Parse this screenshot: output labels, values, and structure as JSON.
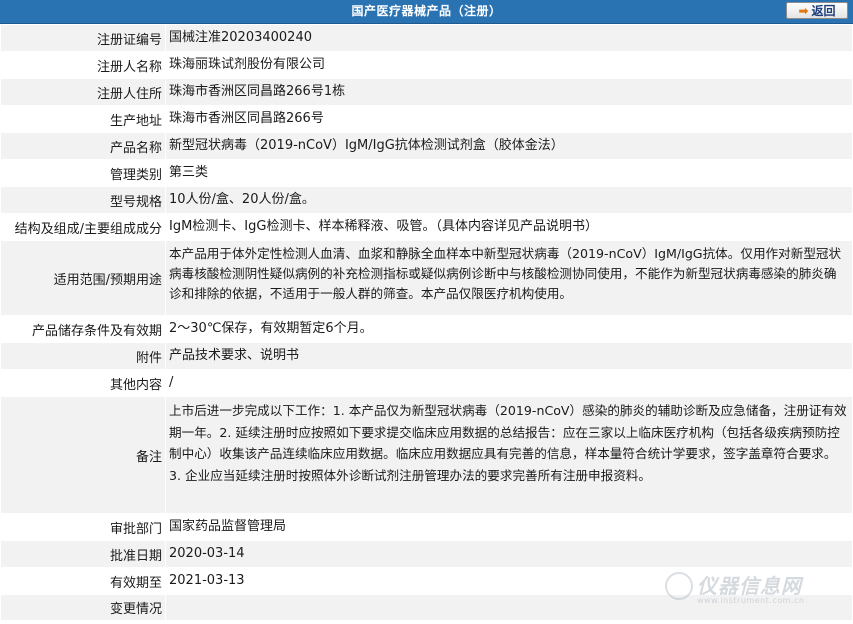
{
  "header": {
    "title": "国产医疗器械产品（注册）",
    "back_label": "返回"
  },
  "rows": [
    {
      "label": "注册证编号",
      "value": "国械注准20203400240"
    },
    {
      "label": "注册人名称",
      "value": "珠海丽珠试剂股份有限公司"
    },
    {
      "label": "注册人住所",
      "value": "珠海市香洲区同昌路266号1栋"
    },
    {
      "label": "生产地址",
      "value": "珠海市香洲区同昌路266号"
    },
    {
      "label": "产品名称",
      "value": "新型冠状病毒（2019-nCoV）IgM/IgG抗体检测试剂盒（胶体金法）"
    },
    {
      "label": "管理类别",
      "value": "第三类"
    },
    {
      "label": "型号规格",
      "value": "10人份/盒、20人份/盒。"
    },
    {
      "label": "结构及组成/主要组成成分",
      "value": "IgM检测卡、IgG检测卡、样本稀释液、吸管。（具体内容详见产品说明书）"
    },
    {
      "label": "适用范围/预期用途",
      "value": "本产品用于体外定性检测人血清、血浆和静脉全血样本中新型冠状病毒（2019-nCoV）IgM/IgG抗体。仅用作对新型冠状病毒核酸检测阴性疑似病例的补充检测指标或疑似病例诊断中与核酸检测协同使用，不能作为新型冠状病毒感染的肺炎确诊和排除的依据，不适用于一般人群的筛查。本产品仅限医疗机构使用。"
    },
    {
      "label": "产品储存条件及有效期",
      "value": "2～30℃保存，有效期暂定6个月。"
    },
    {
      "label": "附件",
      "value": "产品技术要求、说明书"
    },
    {
      "label": "其他内容",
      "value": "/"
    },
    {
      "label": "备注",
      "value": "上市后进一步完成以下工作：1. 本产品仅为新型冠状病毒（2019-nCoV）感染的肺炎的辅助诊断及应急储备，注册证有效期一年。2. 延续注册时应按照如下要求提交临床应用数据的总结报告：应在三家以上临床医疗机构（包括各级疾病预防控制中心）收集该产品连续临床应用数据。临床应用数据应具有完善的信息，样本量符合统计学要求，签字盖章符合要求。3. 企业应当延续注册时按照体外诊断试剂注册管理办法的要求完善所有注册申报资料。"
    },
    {
      "label": "审批部门",
      "value": "国家药品监督管理局"
    },
    {
      "label": "批准日期",
      "value": "2020-03-14"
    },
    {
      "label": "有效期至",
      "value": "2021-03-13"
    },
    {
      "label": "变更情况",
      "value": ""
    }
  ],
  "watermark": {
    "text": "仪器信息网",
    "url": "www.instrument.com.cn"
  }
}
